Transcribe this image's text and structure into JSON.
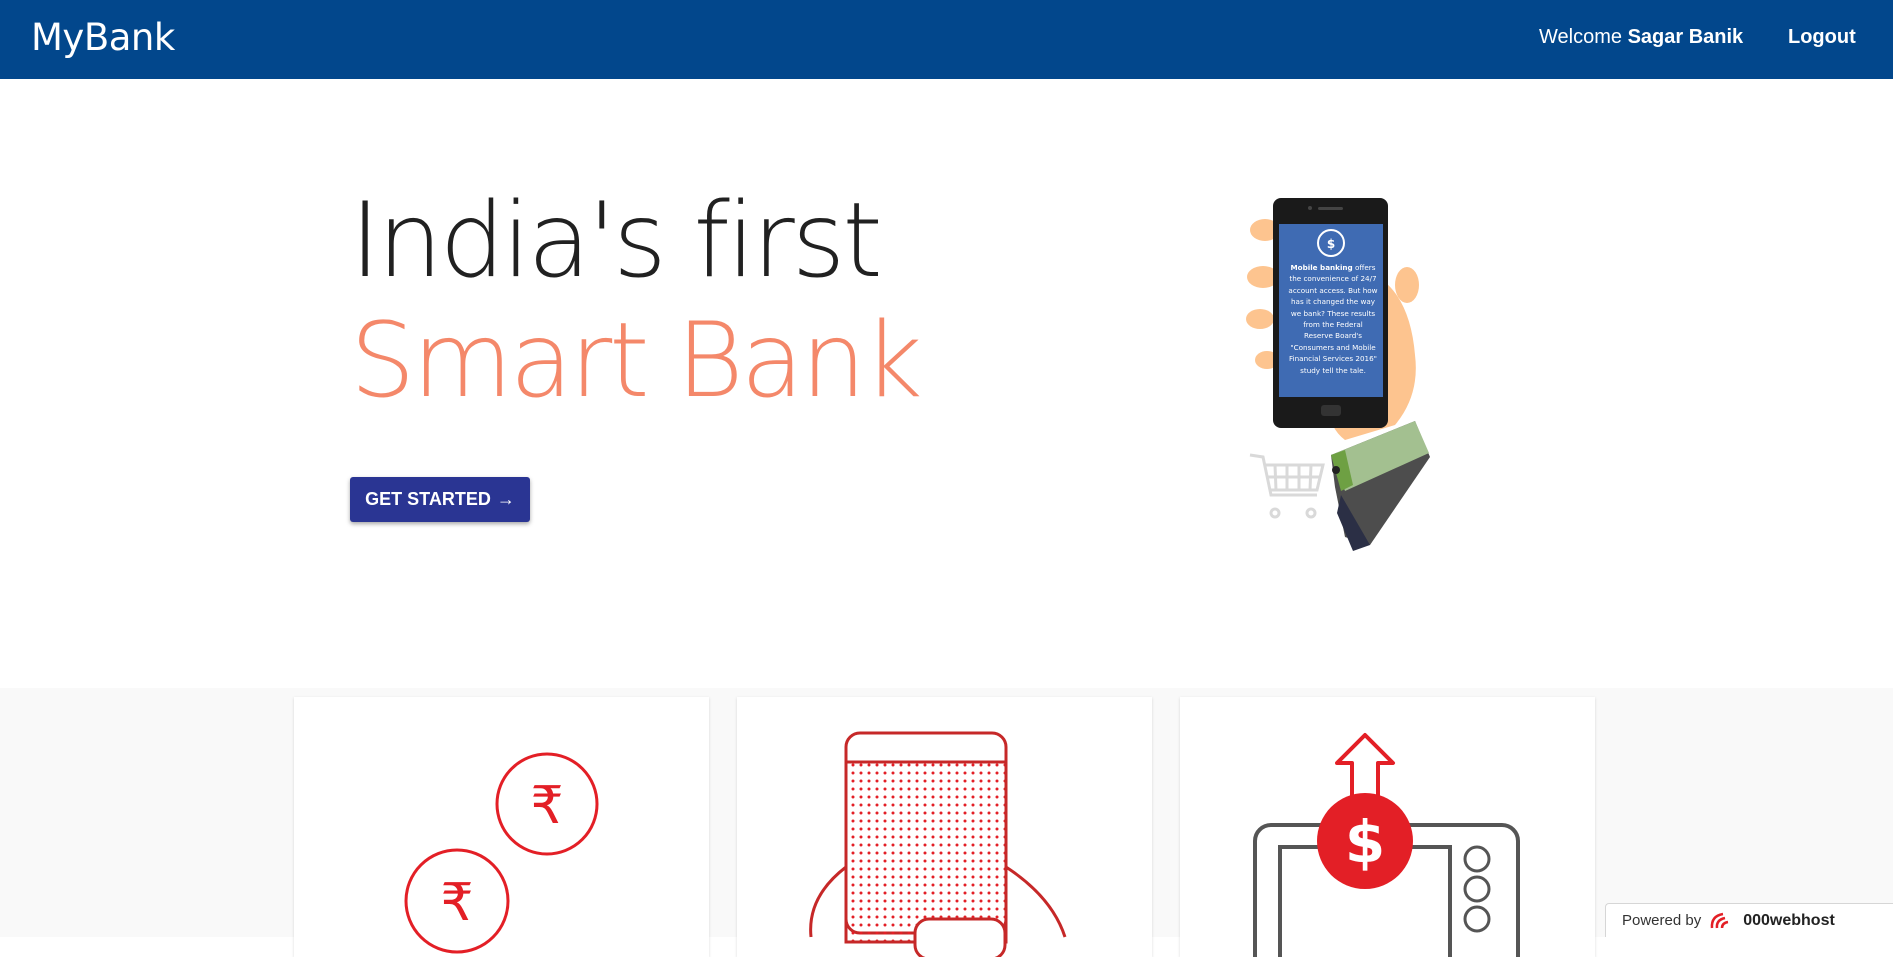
{
  "navbar": {
    "brand": "MyBank",
    "welcome_prefix": "Welcome",
    "user_name": "Sagar Banik",
    "logout_label": "Logout",
    "background": "#02478c"
  },
  "hero": {
    "line1": "India's first",
    "line2": "Smart Bank",
    "cta_label": "GET STARTED",
    "cta_arrow": "→",
    "accent_color": "#f4886a",
    "cta_color": "#2a3593"
  },
  "phone": {
    "bold": "Mobile banking",
    "text": "offers the convenience of 24/7 account access. But how has it changed the way we bank? These results from the Federal Reserve Board's \"Consumers and Mobile Financial Services 2016\" study tell the tale."
  },
  "cards": [
    {
      "icon": "rupee-coins-icon"
    },
    {
      "icon": "mobile-hand-icon"
    },
    {
      "icon": "dollar-atm-icon"
    }
  ],
  "footer_badge": {
    "prefix": "Powered by",
    "brand": "000webhost"
  }
}
